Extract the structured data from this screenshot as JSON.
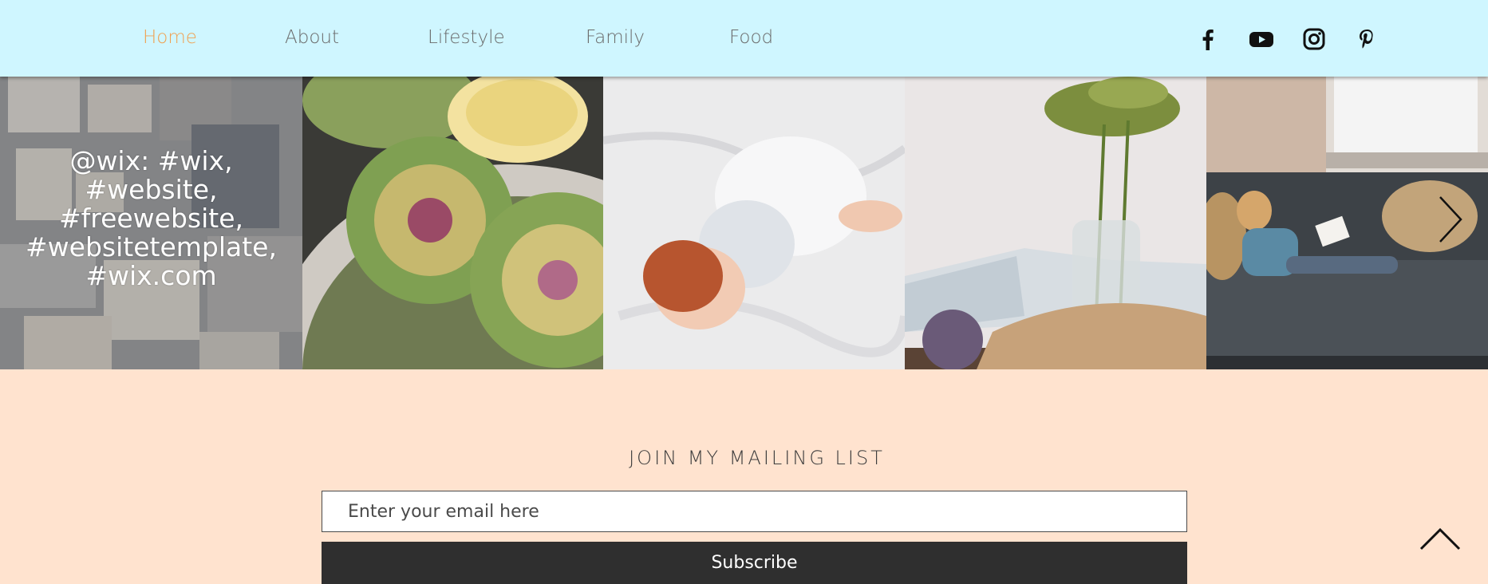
{
  "nav": {
    "items": [
      {
        "label": "Home",
        "active": true
      },
      {
        "label": "About",
        "active": false
      },
      {
        "label": "Lifestyle",
        "active": false
      },
      {
        "label": "Family",
        "active": false
      },
      {
        "label": "Food",
        "active": false
      }
    ]
  },
  "social": [
    "facebook-icon",
    "youtube-icon",
    "instagram-icon",
    "pinterest-icon"
  ],
  "gallery": {
    "overlay_text": "@wix: #wix,\n#website,\n#freewebsite,\n#websitetemplate,\n#wix.com",
    "next_icon": "chevron-right-icon"
  },
  "mailing": {
    "title": "JOIN MY MAILING LIST",
    "email_placeholder": "Enter your email here",
    "subscribe_label": "Subscribe"
  },
  "colors": {
    "header_bg": "#cff6ff",
    "page_bg": "#ffe3cf",
    "nav_active": "#f0a050",
    "nav_text": "#6a6a6a",
    "button_bg": "#2f2f2f"
  }
}
